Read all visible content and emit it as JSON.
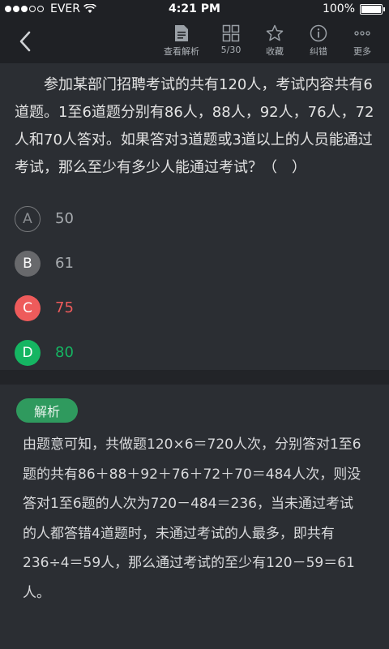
{
  "status_bar": {
    "carrier": "EVER",
    "time": "4:21 PM",
    "battery": "100%"
  },
  "toolbar": {
    "back_icon": "chevron-left-icon",
    "tools": [
      {
        "label": "查看解析",
        "icon": "document-icon"
      },
      {
        "label": "5/30",
        "icon": "grid-icon"
      },
      {
        "label": "收藏",
        "icon": "star-icon"
      },
      {
        "label": "纠错",
        "icon": "info-icon"
      },
      {
        "label": "更多",
        "icon": "more-icon"
      }
    ]
  },
  "question": {
    "text": "参加某部门招聘考试的共有120人，考试内容共有6道题。1至6道题分别有86人，88人，92人，76人，72人和70人答对。如果答对3道题或3道以上的人员能通过考试，那么至少有多少人能通过考试？（　）"
  },
  "options": [
    {
      "letter": "A",
      "text": "50",
      "state": "unselected"
    },
    {
      "letter": "B",
      "text": "61",
      "state": "neutral"
    },
    {
      "letter": "C",
      "text": "75",
      "state": "wrong"
    },
    {
      "letter": "D",
      "text": "80",
      "state": "correct"
    }
  ],
  "analysis": {
    "tag": "解析",
    "text": "由题意可知，共做题120×6＝720人次，分别答对1至6题的共有86＋88＋92＋76＋72＋70＝484人次，则没答对1至6题的人次为720－484＝236，当未通过考试的人都答错4道题时，未通过考试的人最多，即共有236÷4＝59人，那么通过考试的至少有120－59＝61人。"
  },
  "colors": {
    "background": "#2b2e33",
    "toolbar": "#1f2125",
    "wrong": "#ee5b5b",
    "correct": "#15b562",
    "tag": "#2f9a5e"
  }
}
